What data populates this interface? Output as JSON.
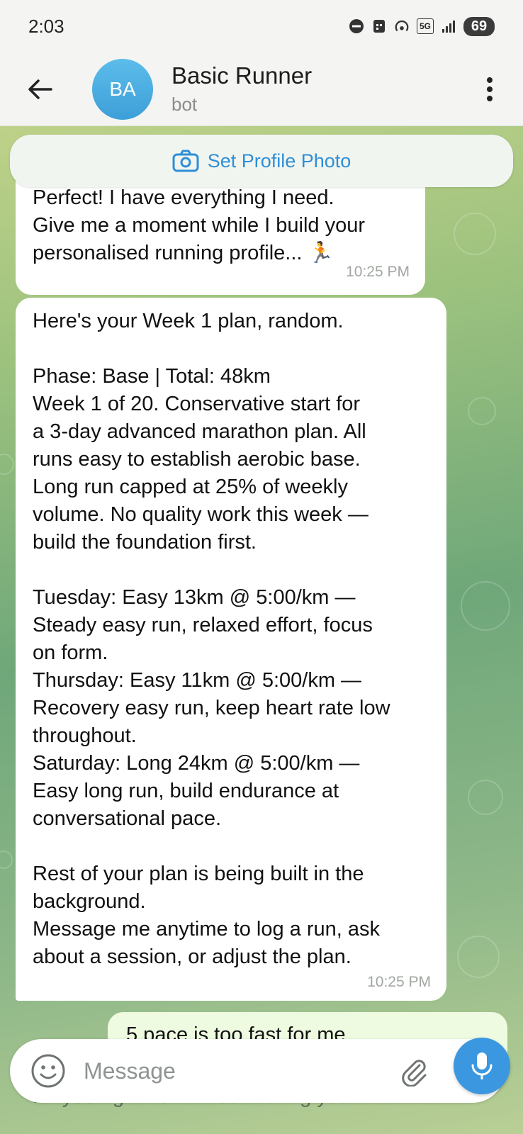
{
  "status_bar": {
    "time": "2:03",
    "battery": "69",
    "network": "5G"
  },
  "header": {
    "avatar_initials": "BA",
    "title": "Basic Runner",
    "subtitle": "bot"
  },
  "pinned_banner": {
    "label": "Set Profile Photo"
  },
  "messages": [
    {
      "text": "Perfect! I have everything I need.\nGive me a moment while I build your\npersonalised running profile... 🏃",
      "time": "10:25 PM"
    },
    {
      "text": "Here's your Week 1 plan, random.\n\nPhase: Base | Total: 48km\nWeek 1 of 20. Conservative start for\na 3-day advanced marathon plan. All\nruns easy to establish aerobic base.\nLong run capped at 25% of weekly\nvolume. No quality work this week —\nbuild the foundation first.\n\nTuesday: Easy 13km @ 5:00/km —\nSteady easy run, relaxed effort, focus\non form.\nThursday: Easy 11km @ 5:00/km —\nRecovery easy run, keep heart rate low\nthroughout.\nSaturday: Long 24km @ 5:00/km —\nEasy long run, build endurance at\nconversational pace.\n\nRest of your plan is being built in the\nbackground.\nMessage me anytime to log a run, ask\nabout a session, or adjust the plan.",
      "time": "10:25 PM"
    },
    {
      "text": "5 pace is too fast for me"
    },
    {
      "text": "for you right now — something you"
    }
  ],
  "composer": {
    "placeholder": "Message"
  },
  "colors": {
    "accent": "#3a97e0",
    "outgoing_bubble": "#eefbe0",
    "incoming_bubble": "#ffffff"
  },
  "icons": {
    "back": "arrow-left-icon",
    "menu": "more-vertical-icon",
    "camera": "camera-icon",
    "emoji": "emoji-icon",
    "attach": "paperclip-icon",
    "mic": "microphone-icon"
  }
}
